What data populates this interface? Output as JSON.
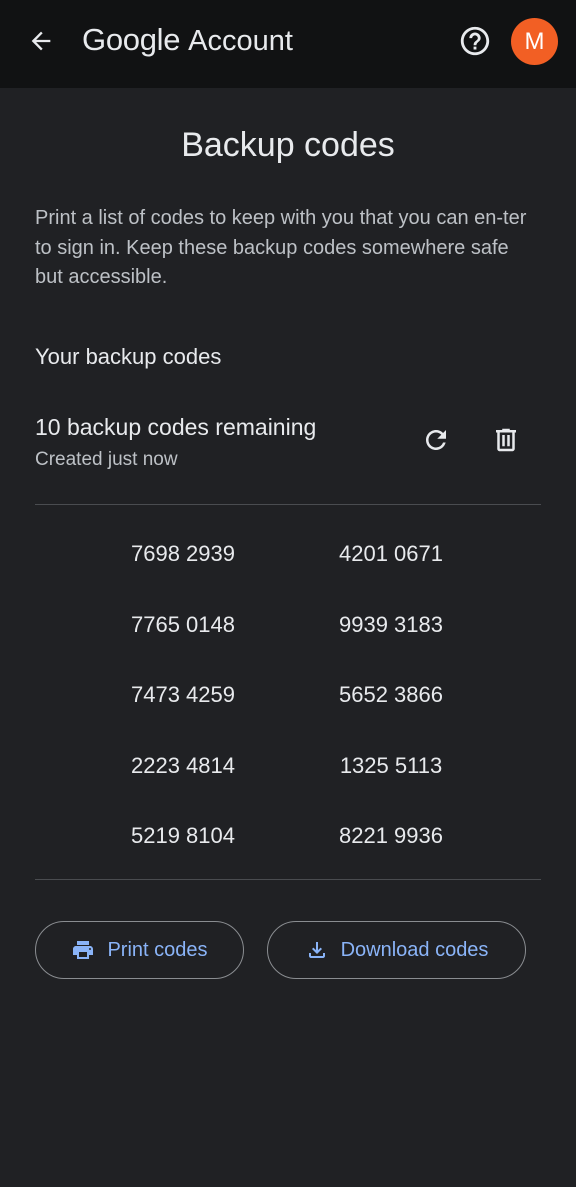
{
  "header": {
    "brand_google": "Google",
    "brand_account": "Account",
    "avatar_letter": "M",
    "icons": {
      "back": "arrow-back-icon",
      "help": "help-circle-icon"
    },
    "colors": {
      "bar_background": "#111213",
      "avatar_background": "#f25f24"
    }
  },
  "page": {
    "title": "Backup codes",
    "description": "Print a list of codes to keep with you that you can en-ter to sign in. Keep these backup codes somewhere safe but accessible.",
    "section_heading": "Your backup codes",
    "remaining": "10 backup codes remaining",
    "created": "Created just now",
    "icons": {
      "refresh": "refresh-icon",
      "delete": "delete-icon"
    },
    "codes": [
      [
        "7698 2939",
        "4201 0671"
      ],
      [
        "7765 0148",
        "9939 3183"
      ],
      [
        "7473 4259",
        "5652 3866"
      ],
      [
        "2223 4814",
        "1325 5113"
      ],
      [
        "5219 8104",
        "8221 9936"
      ]
    ]
  },
  "actions": {
    "print_label": "Print codes",
    "download_label": "Download codes",
    "icons": {
      "print": "printer-icon",
      "download": "download-icon"
    },
    "colors": {
      "accent": "#8ab4f8"
    }
  }
}
